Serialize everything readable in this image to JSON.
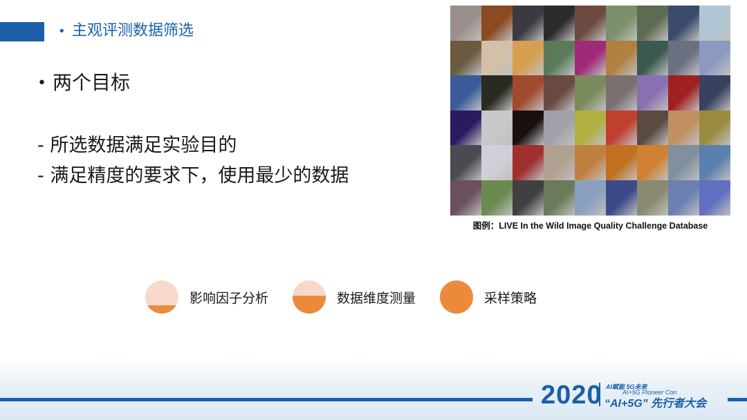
{
  "header": {
    "bullet": "•",
    "title": "主观评测数据筛选"
  },
  "body": {
    "goal_bullet": "•",
    "goal": "两个目标",
    "items": [
      "- 所选数据满足实验目的",
      "- 满足精度的要求下，使用最少的数据"
    ]
  },
  "figure": {
    "caption": "图例：LIVE In the Wild Image Quality Challenge Database",
    "tile_colors": [
      "#9a8f8a",
      "#8a4a22",
      "#3a3a40",
      "#2b2b2e",
      "#6d4a40",
      "#7a8f6a",
      "#5c6b52",
      "#3a4b6c",
      "#b0c6d6",
      "#6a5a40",
      "#d3c0a8",
      "#d6a050",
      "#5b7a5a",
      "#a02a7a",
      "#b08040",
      "#3a5a50",
      "#6a7080",
      "#8a9ac0",
      "#3a5a9a",
      "#2a2a20",
      "#a04a30",
      "#6a4a40",
      "#7a8a5a",
      "#7a7070",
      "#8a70b0",
      "#a02020",
      "#3a4060",
      "#2a1a60",
      "#c8c8c8",
      "#1a1010",
      "#a0a0a8",
      "#b0b040",
      "#c04030",
      "#5a4a40",
      "#c09060",
      "#9a8a40",
      "#4a4a50",
      "#d0d0d8",
      "#a03030",
      "#b0a090",
      "#c08040",
      "#c07020",
      "#d08030",
      "#8090a0",
      "#5a80b0",
      "#6a5060",
      "#6a8a50",
      "#404040",
      "#6a7a5a",
      "#8aa0c0",
      "#3a4a8a",
      "#8a8a70",
      "#6a80b0",
      "#6070c0"
    ]
  },
  "steps": [
    {
      "label": "影响因子分析",
      "fill_fraction": 0.25
    },
    {
      "label": "数据维度测量",
      "fill_fraction": 0.55
    },
    {
      "label": "采样策略",
      "fill_fraction": 1.0
    }
  ],
  "colors": {
    "brand": "#1a5fa8",
    "accent": "#ec8a3c",
    "accent_light": "#f7d9cc"
  },
  "footer": {
    "year": "2020",
    "tag1": "AI赋能 5G未来",
    "tag2": "AI+5G Pioneer Con",
    "conference": "“AI+5G” 先行者大会"
  }
}
